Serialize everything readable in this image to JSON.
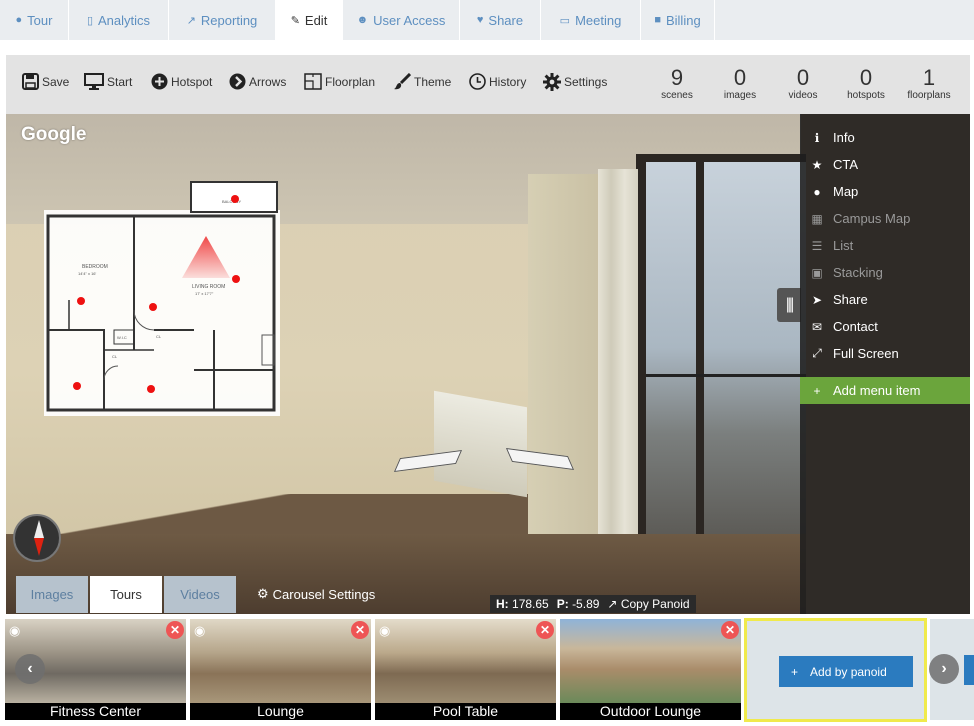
{
  "tabs": [
    {
      "label": "Tour",
      "icon": "map-marker-icon"
    },
    {
      "label": "Analytics",
      "icon": "bar-chart-icon"
    },
    {
      "label": "Reporting",
      "icon": "line-chart-icon"
    },
    {
      "label": "Edit",
      "icon": "pencil-icon",
      "active": true
    },
    {
      "label": "User Access",
      "icon": "users-icon"
    },
    {
      "label": "Share",
      "icon": "heart-icon"
    },
    {
      "label": "Meeting",
      "icon": "monitor-icon"
    },
    {
      "label": "Billing",
      "icon": "lock-icon"
    }
  ],
  "toolbar": {
    "save": "Save",
    "start": "Start",
    "hotspot": "Hotspot",
    "arrows": "Arrows",
    "floorplan": "Floorplan",
    "theme": "Theme",
    "history": "History",
    "settings": "Settings"
  },
  "stats": [
    {
      "value": "9",
      "label": "scenes"
    },
    {
      "value": "0",
      "label": "images"
    },
    {
      "value": "0",
      "label": "videos"
    },
    {
      "value": "0",
      "label": "hotspots"
    },
    {
      "value": "1",
      "label": "floorplans"
    }
  ],
  "viewer": {
    "brand": "Google",
    "floorplan_labels": {
      "balcony": "BALCONY",
      "bedroom": "BEDROOM",
      "bedroom_size": "14'4\" x 16'",
      "living": "LIVING ROOM",
      "living_size": "17' x 17'7\"",
      "wic": "W.I.C",
      "cl1": "CL",
      "cl2": "CL"
    },
    "tabs": [
      "Images",
      "Tours",
      "Videos"
    ],
    "active_tab": "Tours",
    "carousel_settings": "Carousel Settings",
    "h_label": "H:",
    "h_value": "178.65",
    "p_label": "P:",
    "p_value": "-5.89",
    "copy": "Copy Panoid"
  },
  "menu": {
    "items": [
      {
        "label": "Info",
        "icon": "info-icon",
        "dim": false
      },
      {
        "label": "CTA",
        "icon": "star-icon",
        "dim": false
      },
      {
        "label": "Map",
        "icon": "map-pin-icon",
        "dim": false
      },
      {
        "label": "Campus Map",
        "icon": "folded-map-icon",
        "dim": true
      },
      {
        "label": "List",
        "icon": "list-icon",
        "dim": true
      },
      {
        "label": "Stacking",
        "icon": "building-icon",
        "dim": true
      },
      {
        "label": "Share",
        "icon": "share-icon",
        "dim": false
      },
      {
        "label": "Contact",
        "icon": "envelope-icon",
        "dim": false
      },
      {
        "label": "Full Screen",
        "icon": "expand-icon",
        "dim": false
      }
    ],
    "add_label": "Add menu item"
  },
  "scenes": [
    {
      "caption": "Fitness Center"
    },
    {
      "caption": "Lounge"
    },
    {
      "caption": "Pool Table"
    },
    {
      "caption": "Outdoor Lounge"
    }
  ],
  "add_panoid": "Add by panoid",
  "colors": {
    "tab_text": "#5d8fc0",
    "menu_add": "#6ba53c",
    "primary_button": "#2b7bbf",
    "highlight_border": "#f0ea4c",
    "delete": "#e55555"
  }
}
